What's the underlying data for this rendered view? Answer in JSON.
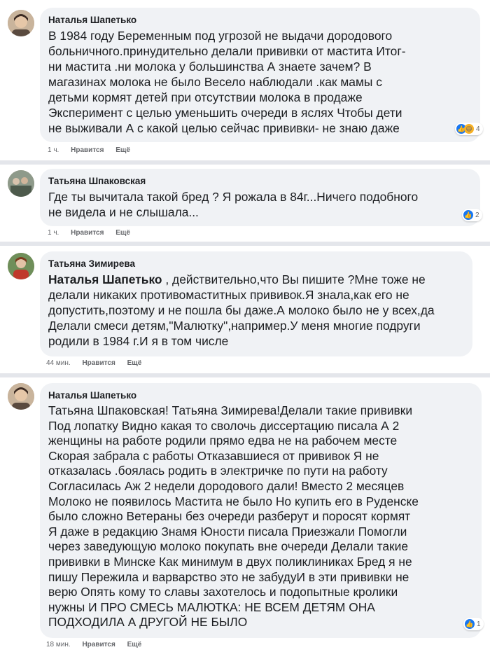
{
  "comments": [
    {
      "author": "Наталья Шапетько",
      "lines": [
        "В 1984 году Беременным под угрозой не выдачи дородового",
        "больничного.принудительно делали прививки от мастита Итог-",
        "ни мастита .ни молока у большинства А знаете зачем? В",
        "магазинах молока не было Весело наблюдали .как мамы с",
        "детьми кормят детей при отсутствии молока в продаже",
        "Эксперимент с целью уменьшить очереди в яслях Чтобы дети",
        "не выживали А с какой целью сейчас прививки- не знаю даже"
      ],
      "time": "1 ч.",
      "like": "Нравится",
      "more": "Ещё",
      "reaction_count": "4",
      "reactions": [
        "like",
        "haha"
      ]
    },
    {
      "author": "Татьяна Шпаковская",
      "lines": [
        "Где ты вычитала такой бред ? Я рожала в 84г...Ничего подобного",
        "не видела и не слышала..."
      ],
      "time": "1 ч.",
      "like": "Нравится",
      "more": "Ещё",
      "reaction_count": "2",
      "reactions": [
        "like"
      ]
    },
    {
      "author": "Татьяна Зимирева",
      "mention": "Наталья Шапетько",
      "first_line_rest": " , действительно,что Вы пишите ?Мне тоже не",
      "lines": [
        "делали никаких противомаститных прививок.Я знала,как его не",
        "допустить,поэтому и не пошла бы даже.А молоко было не у всех,да",
        "Делали смеси детям,\"Малютку\",например.У меня многие подруги",
        "родили в 1984 г.И я в том числе"
      ],
      "time": "44 мин.",
      "like": "Нравится",
      "more": "Ещё"
    },
    {
      "author": "Наталья Шапетько",
      "lines": [
        "Татьяна Шпаковская! Татьяна Зимирева!Делали такие прививки",
        "Под лопатку Видно какая то сволочь диссертацию писала А 2",
        "женщины на работе родили прямо едва не на рабочем месте",
        "Скорая забрала с работы Отказавшиеся от прививок Я не",
        "отказалась .боялась родить в электричке по пути на работу",
        "Согласилась Аж 2 недели дородового дали! Вместо 2 месяцев",
        "Молоко не появилось Мастита не было Но купить его в Руденске",
        "было сложно Ветераны без очереди разберут и поросят кормят",
        "Я даже в редакцию Знамя Юности писала Приезжали Помогли",
        "через заведующую молоко покупать вне очереди Делали такие",
        "прививки в Минске Как минимум в двух поликлиниках Бред я не",
        "пишу Пережила и варварство это не забудуИ в эти прививки не",
        "верю Опять кому то славы захотелось и подопытные кролики",
        "нужны И ПРО СМЕСЬ МАЛЮТКА: НЕ ВСЕМ ДЕТЯМ ОНА",
        "ПОДХОДИЛА А ДРУГОЙ НЕ БЫЛО"
      ],
      "time": "18 мин.",
      "like": "Нравится",
      "more": "Ещё",
      "reaction_count": "1",
      "reactions": [
        "like"
      ]
    }
  ],
  "colors": {
    "bubble": "#f0f2f5",
    "divider": "#e4e6eb",
    "meta": "#65676b",
    "like_blue": "#1877f2"
  }
}
